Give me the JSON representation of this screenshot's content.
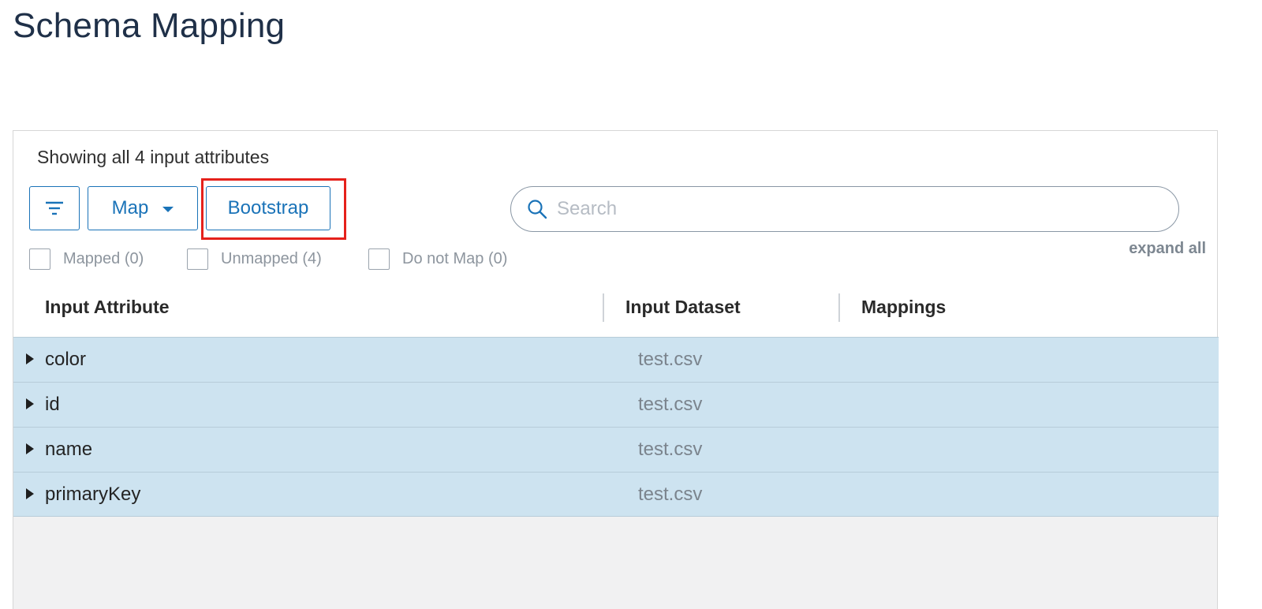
{
  "page": {
    "title": "Schema Mapping"
  },
  "toolbar": {
    "showing_text": "Showing all 4 input attributes",
    "map_label": "Map",
    "bootstrap_label": "Bootstrap",
    "search_placeholder": "Search",
    "expand_all": "expand all"
  },
  "filters": [
    {
      "label": "Mapped (0)",
      "checked": false
    },
    {
      "label": "Unmapped (4)",
      "checked": false
    },
    {
      "label": "Do not Map (0)",
      "checked": false
    }
  ],
  "table": {
    "columns": [
      "Input Attribute",
      "Input Dataset",
      "Mappings"
    ],
    "rows": [
      {
        "attribute": "color",
        "dataset": "test.csv",
        "mappings": ""
      },
      {
        "attribute": "id",
        "dataset": "test.csv",
        "mappings": ""
      },
      {
        "attribute": "name",
        "dataset": "test.csv",
        "mappings": ""
      },
      {
        "attribute": "primaryKey",
        "dataset": "test.csv",
        "mappings": ""
      }
    ]
  },
  "colors": {
    "accent": "#1a73b8",
    "row_highlight": "#cde3f0",
    "annotation_box": "#e5211b",
    "title": "#1f3048"
  },
  "icons": [
    "filter-icon",
    "chevron-down-icon",
    "search-icon",
    "expand-arrow-icon"
  ]
}
